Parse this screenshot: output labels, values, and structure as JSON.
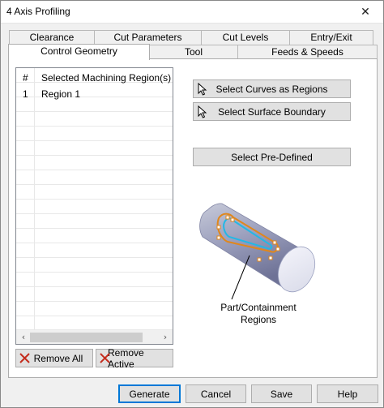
{
  "window": {
    "title": "4 Axis Profiling",
    "close_glyph": "✕"
  },
  "tabs": {
    "row1": [
      "Clearance",
      "Cut Parameters",
      "Cut Levels",
      "Entry/Exit"
    ],
    "row2": [
      "Control Geometry",
      "Tool",
      "Feeds & Speeds"
    ],
    "active": "Control Geometry"
  },
  "region_list": {
    "headers": {
      "num": "#",
      "name": "Selected Machining Region(s)"
    },
    "rows": [
      {
        "num": "1",
        "name": "Region 1"
      }
    ]
  },
  "buttons": {
    "select_curves": "Select Curves as Regions",
    "select_surface": "Select Surface Boundary",
    "select_predefined": "Select Pre-Defined",
    "remove_all": "Remove All",
    "remove_active": "Remove Active",
    "generate": "Generate",
    "cancel": "Cancel",
    "save": "Save",
    "help": "Help"
  },
  "illustration": {
    "caption_line1": "Part/Containment",
    "caption_line2": "Regions"
  },
  "icons": {
    "cursor": "cursor-arrow-icon",
    "remove": "red-x-icon",
    "remove_color": "#c42b1c"
  }
}
